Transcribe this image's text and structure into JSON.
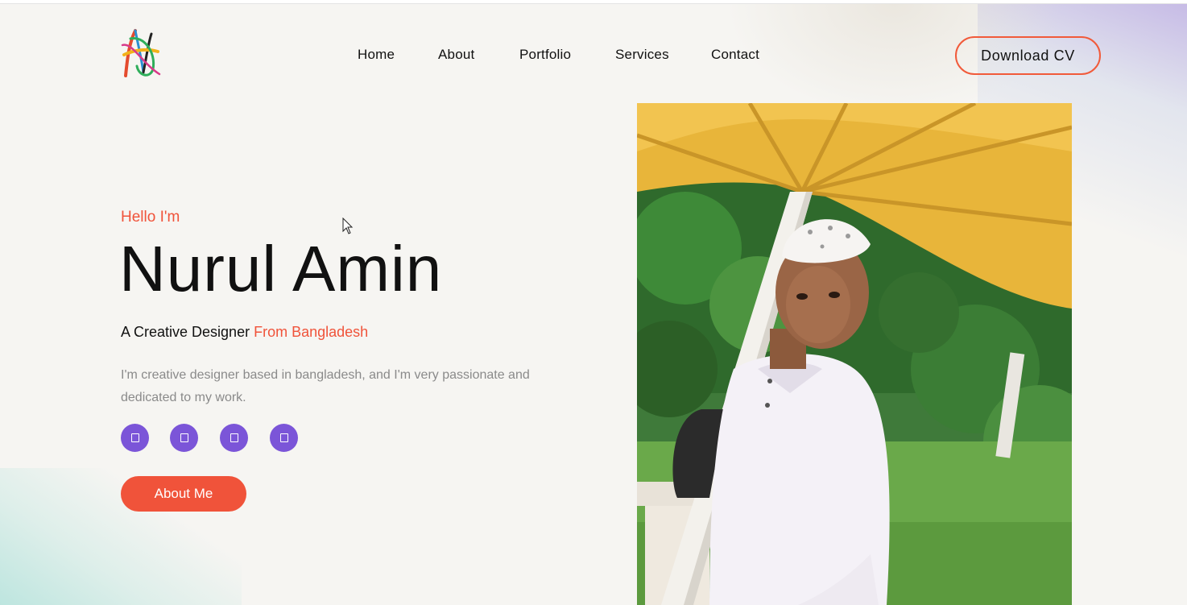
{
  "nav": {
    "items": [
      {
        "label": "Home"
      },
      {
        "label": "About"
      },
      {
        "label": "Portfolio"
      },
      {
        "label": "Services"
      },
      {
        "label": "Contact"
      }
    ],
    "cv_button": "Download CV"
  },
  "hero": {
    "greeting": "Hello I'm",
    "name": "Nurul Amin",
    "tagline_main": "A Creative Designer",
    "tagline_accent": "From Bangladesh",
    "description": "I'm creative designer based in bangladesh, and I'm very passionate and dedicated to my work.",
    "social_icons": [
      "facebook-icon",
      "twitter-icon",
      "instagram-icon",
      "linkedin-icon"
    ],
    "social_glyph": "□",
    "about_button": "About Me"
  },
  "colors": {
    "accent": "#f0533a",
    "social_bg": "#7b55d8",
    "background": "#f6f5f2"
  }
}
